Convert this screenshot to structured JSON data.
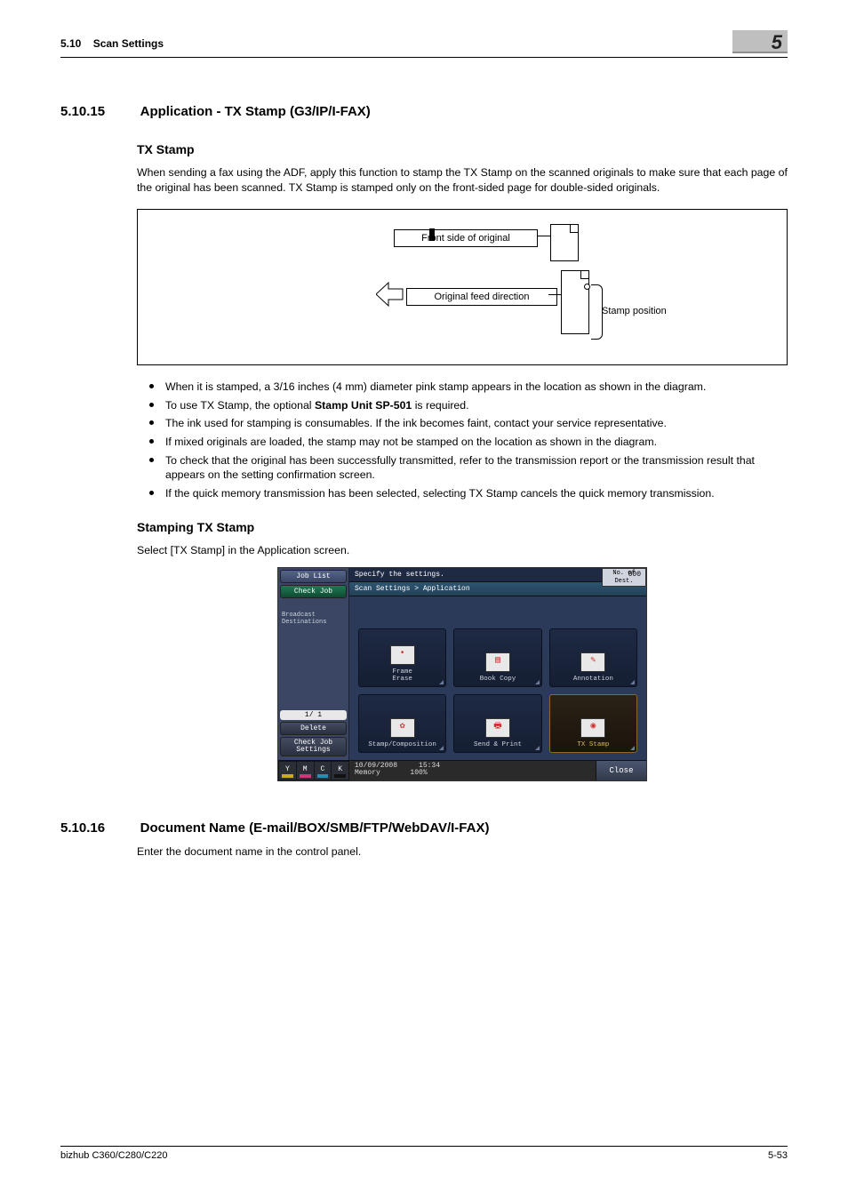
{
  "header": {
    "section_num": "5.10",
    "section_title": "Scan Settings",
    "chapter_num": "5"
  },
  "s1": {
    "num": "5.10.15",
    "title": "Application - TX Stamp (G3/IP/I-FAX)",
    "h1": "TX Stamp",
    "p1": "When sending a fax using the ADF, apply this function to stamp the TX Stamp on the scanned originals to make sure that each page of the original has been scanned. TX Stamp is stamped only on the front-sided page for double-sided originals.",
    "diagram": {
      "front": "Front side of original",
      "feed": "Original feed direction",
      "stamp": "Stamp position"
    },
    "bullets": [
      "When it is stamped, a 3/16 inches (4 mm) diameter pink stamp appears in the location as shown in the diagram.",
      "To use TX Stamp, the optional Stamp Unit SP-501 is required.",
      "The ink used for stamping is consumables. If the ink becomes faint, contact your service representative.",
      "If mixed originals are loaded, the stamp may not be stamped on the location as shown in the diagram.",
      "To check that the original has been successfully transmitted, refer to the transmission report or the transmission result that appears on the setting confirmation screen.",
      "If the quick memory transmission has been selected, selecting TX Stamp cancels the quick memory transmission."
    ],
    "bullet1_bold": "Stamp Unit SP-501",
    "h2": "Stamping TX Stamp",
    "p2": "Select [TX Stamp] in the Application screen."
  },
  "panel": {
    "job_list": "Job List",
    "check_job": "Check Job",
    "specify": "Specify the settings.",
    "dest_label": "No. of\nDest.",
    "dest_val": "000",
    "crumb": "Scan Settings > Application",
    "broadcast": "Broadcast\nDestinations",
    "page": "1/  1",
    "delete": "Delete",
    "check_settings": "Check Job\nSettings",
    "apps": [
      "Frame\nErase",
      "Book Copy",
      "Annotation",
      "Stamp/Composition",
      "Send & Print",
      "TX Stamp"
    ],
    "date": "10/09/2008",
    "time": "15:34",
    "mem_label": "Memory",
    "mem_val": "100%",
    "close": "Close",
    "toner": [
      "Y",
      "M",
      "C",
      "K"
    ]
  },
  "s2": {
    "num": "5.10.16",
    "title": "Document Name (E-mail/BOX/SMB/FTP/WebDAV/I-FAX)",
    "p1": "Enter the document name in the control panel."
  },
  "footer": {
    "left": "bizhub C360/C280/C220",
    "right": "5-53"
  }
}
